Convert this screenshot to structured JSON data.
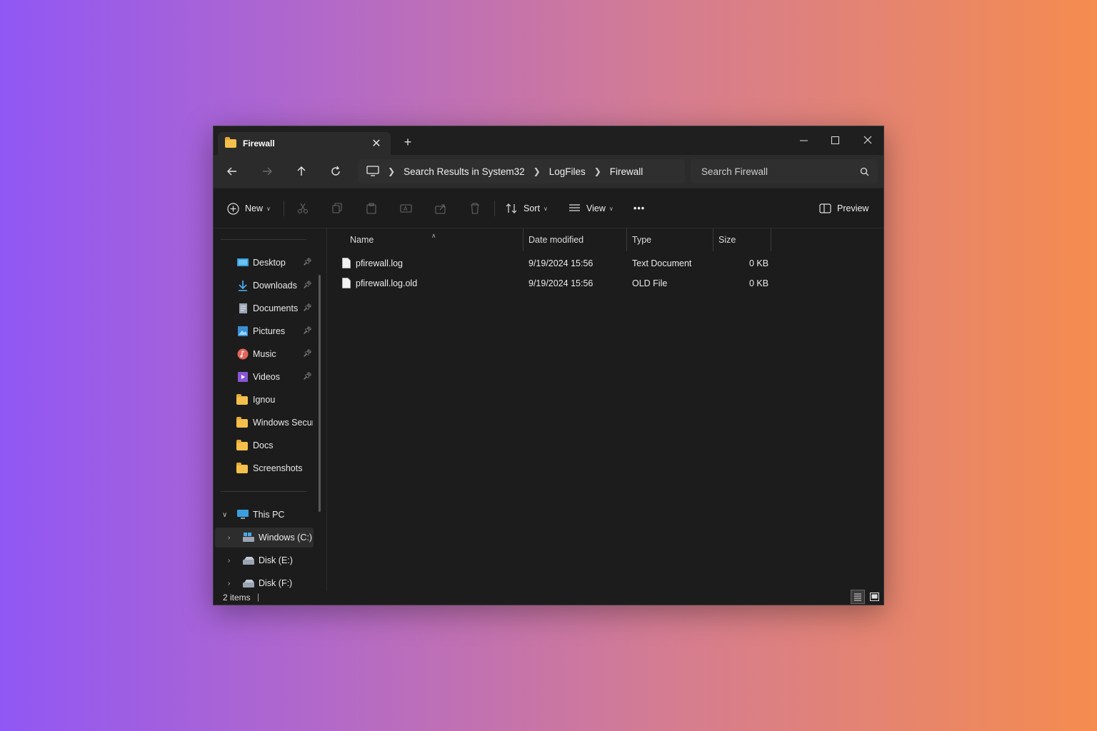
{
  "window": {
    "tab_title": "Firewall",
    "new_tab_symbol": "+"
  },
  "navbar": {
    "breadcrumb": [
      "Search Results in System32",
      "LogFiles",
      "Firewall"
    ],
    "search_placeholder": "Search Firewall"
  },
  "toolbar": {
    "new_label": "New",
    "sort_label": "Sort",
    "view_label": "View",
    "more_label": "•••",
    "preview_label": "Preview"
  },
  "sidebar": {
    "quick_access": [
      {
        "label": "Desktop",
        "icon": "desktop-icon",
        "pinned": true
      },
      {
        "label": "Downloads",
        "icon": "downloads-icon",
        "pinned": true
      },
      {
        "label": "Documents",
        "icon": "documents-icon",
        "pinned": true
      },
      {
        "label": "Pictures",
        "icon": "pictures-icon",
        "pinned": true
      },
      {
        "label": "Music",
        "icon": "music-icon",
        "pinned": true
      },
      {
        "label": "Videos",
        "icon": "videos-icon",
        "pinned": true
      },
      {
        "label": "Ignou",
        "icon": "folder-icon",
        "pinned": false
      },
      {
        "label": "Windows Securi",
        "icon": "folder-icon",
        "pinned": false
      },
      {
        "label": "Docs",
        "icon": "folder-icon",
        "pinned": false
      },
      {
        "label": "Screenshots",
        "icon": "folder-icon",
        "pinned": false
      }
    ],
    "this_pc": "This PC",
    "drives": [
      "Windows (C:)",
      "Disk (E:)",
      "Disk (F:)"
    ]
  },
  "table": {
    "columns": [
      "Name",
      "Date modified",
      "Type",
      "Size"
    ],
    "rows": [
      {
        "name": "pfirewall.log",
        "date": "9/19/2024 15:56",
        "type": "Text Document",
        "size": "0 KB"
      },
      {
        "name": "pfirewall.log.old",
        "date": "9/19/2024 15:56",
        "type": "OLD File",
        "size": "0 KB"
      }
    ]
  },
  "status": {
    "count": "2 items",
    "separator": "|"
  }
}
